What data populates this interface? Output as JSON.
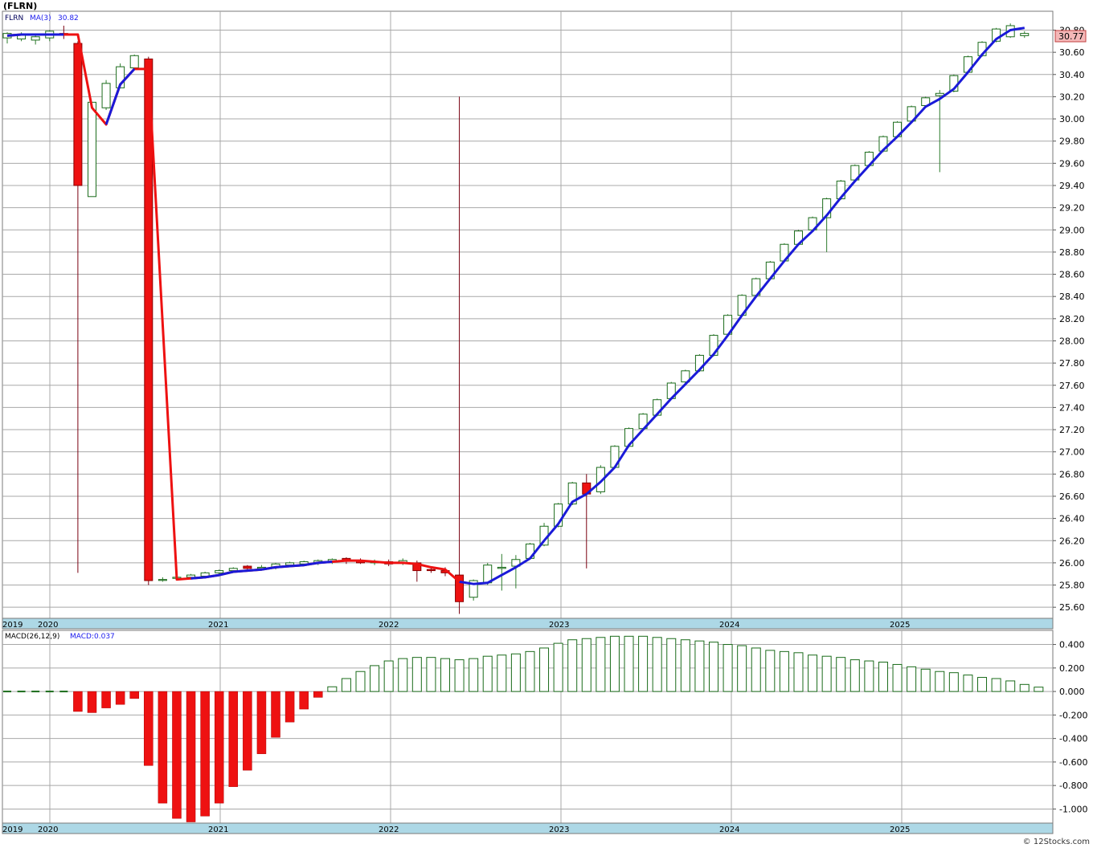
{
  "title": "(FLRN)",
  "watermark": "© 12Stocks.com",
  "chart_data": [
    {
      "type": "candlestick",
      "ticker": "FLRN",
      "ma_label": "MA(3)",
      "ma_value": "30.82",
      "last_price": "30.77",
      "ylim": [
        25.5,
        30.97
      ],
      "yticks": [
        "30.80",
        "30.60",
        "30.40",
        "30.20",
        "30.00",
        "29.80",
        "29.60",
        "29.40",
        "29.20",
        "29.00",
        "28.80",
        "28.60",
        "28.40",
        "28.20",
        "28.00",
        "27.80",
        "27.60",
        "27.40",
        "27.20",
        "27.00",
        "26.80",
        "26.60",
        "26.40",
        "26.20",
        "26.00",
        "25.80",
        "25.60"
      ],
      "year_labels": [
        "2019",
        "2020",
        "2021",
        "2022",
        "2023",
        "2024",
        "2025"
      ],
      "candles": [
        {
          "o": 30.73,
          "h": 30.78,
          "l": 30.68,
          "c": 30.77
        },
        {
          "o": 30.72,
          "h": 30.78,
          "l": 30.7,
          "c": 30.76
        },
        {
          "o": 30.71,
          "h": 30.76,
          "l": 30.67,
          "c": 30.74
        },
        {
          "o": 30.73,
          "h": 30.8,
          "l": 30.7,
          "c": 30.79
        },
        {
          "o": 30.77,
          "h": 30.84,
          "l": 30.72,
          "c": 30.76
        },
        {
          "o": 30.68,
          "h": 30.7,
          "l": 25.91,
          "c": 29.4
        },
        {
          "o": 29.3,
          "h": 30.15,
          "l": 29.3,
          "c": 30.15
        },
        {
          "o": 30.1,
          "h": 30.35,
          "l": 30.08,
          "c": 30.32
        },
        {
          "o": 30.28,
          "h": 30.5,
          "l": 30.28,
          "c": 30.47
        },
        {
          "o": 30.46,
          "h": 30.58,
          "l": 30.46,
          "c": 30.57
        },
        {
          "o": 30.54,
          "h": 30.56,
          "l": 25.8,
          "c": 25.84
        },
        {
          "o": 25.85,
          "h": 25.87,
          "l": 25.83,
          "c": 25.85
        },
        {
          "o": 25.86,
          "h": 25.89,
          "l": 25.84,
          "c": 25.87
        },
        {
          "o": 25.87,
          "h": 25.9,
          "l": 25.85,
          "c": 25.89
        },
        {
          "o": 25.88,
          "h": 25.92,
          "l": 25.86,
          "c": 25.91
        },
        {
          "o": 25.91,
          "h": 25.94,
          "l": 25.89,
          "c": 25.93
        },
        {
          "o": 25.93,
          "h": 25.96,
          "l": 25.91,
          "c": 25.95
        },
        {
          "o": 25.97,
          "h": 25.98,
          "l": 25.93,
          "c": 25.95
        },
        {
          "o": 25.95,
          "h": 25.98,
          "l": 25.93,
          "c": 25.96
        },
        {
          "o": 25.96,
          "h": 26.0,
          "l": 25.94,
          "c": 25.99
        },
        {
          "o": 25.98,
          "h": 26.01,
          "l": 25.96,
          "c": 26.0
        },
        {
          "o": 25.99,
          "h": 26.02,
          "l": 25.97,
          "c": 26.01
        },
        {
          "o": 26.0,
          "h": 26.03,
          "l": 25.98,
          "c": 26.02
        },
        {
          "o": 26.01,
          "h": 26.04,
          "l": 25.99,
          "c": 26.03
        },
        {
          "o": 26.04,
          "h": 26.05,
          "l": 25.99,
          "c": 26.02
        },
        {
          "o": 26.02,
          "h": 26.04,
          "l": 25.99,
          "c": 26.0
        },
        {
          "o": 26.0,
          "h": 26.03,
          "l": 25.98,
          "c": 26.01
        },
        {
          "o": 26.01,
          "h": 26.03,
          "l": 25.97,
          "c": 25.99
        },
        {
          "o": 26.0,
          "h": 26.04,
          "l": 25.98,
          "c": 26.02
        },
        {
          "o": 26.0,
          "h": 26.02,
          "l": 25.83,
          "c": 25.93
        },
        {
          "o": 25.94,
          "h": 25.97,
          "l": 25.91,
          "c": 25.93
        },
        {
          "o": 25.93,
          "h": 25.96,
          "l": 25.88,
          "c": 25.91
        },
        {
          "o": 25.89,
          "h": 30.2,
          "l": 25.54,
          "c": 25.65
        },
        {
          "o": 25.69,
          "h": 25.85,
          "l": 25.66,
          "c": 25.84
        },
        {
          "o": 25.82,
          "h": 26.0,
          "l": 25.8,
          "c": 25.98
        },
        {
          "o": 25.95,
          "h": 26.08,
          "l": 25.75,
          "c": 25.96
        },
        {
          "o": 25.97,
          "h": 26.07,
          "l": 25.77,
          "c": 26.03
        },
        {
          "o": 26.04,
          "h": 26.18,
          "l": 26.03,
          "c": 26.17
        },
        {
          "o": 26.16,
          "h": 26.36,
          "l": 26.15,
          "c": 26.33
        },
        {
          "o": 26.33,
          "h": 26.54,
          "l": 26.32,
          "c": 26.53
        },
        {
          "o": 26.53,
          "h": 26.73,
          "l": 26.52,
          "c": 26.72
        },
        {
          "o": 26.72,
          "h": 26.8,
          "l": 25.95,
          "c": 26.62
        },
        {
          "o": 26.64,
          "h": 26.88,
          "l": 26.62,
          "c": 26.86
        },
        {
          "o": 26.86,
          "h": 27.06,
          "l": 26.85,
          "c": 27.05
        },
        {
          "o": 27.05,
          "h": 27.22,
          "l": 27.04,
          "c": 27.21
        },
        {
          "o": 27.21,
          "h": 27.35,
          "l": 27.2,
          "c": 27.34
        },
        {
          "o": 27.33,
          "h": 27.48,
          "l": 27.32,
          "c": 27.47
        },
        {
          "o": 27.48,
          "h": 27.63,
          "l": 27.47,
          "c": 27.62
        },
        {
          "o": 27.63,
          "h": 27.74,
          "l": 27.62,
          "c": 27.73
        },
        {
          "o": 27.73,
          "h": 27.88,
          "l": 27.72,
          "c": 27.87
        },
        {
          "o": 27.87,
          "h": 28.06,
          "l": 27.86,
          "c": 28.05
        },
        {
          "o": 28.06,
          "h": 28.24,
          "l": 28.05,
          "c": 28.23
        },
        {
          "o": 28.23,
          "h": 28.42,
          "l": 28.22,
          "c": 28.41
        },
        {
          "o": 28.41,
          "h": 28.57,
          "l": 28.4,
          "c": 28.56
        },
        {
          "o": 28.56,
          "h": 28.72,
          "l": 28.55,
          "c": 28.71
        },
        {
          "o": 28.72,
          "h": 28.88,
          "l": 28.71,
          "c": 28.87
        },
        {
          "o": 28.87,
          "h": 29.0,
          "l": 28.86,
          "c": 28.99
        },
        {
          "o": 29.0,
          "h": 29.12,
          "l": 28.99,
          "c": 29.11
        },
        {
          "o": 29.11,
          "h": 29.29,
          "l": 28.8,
          "c": 29.28
        },
        {
          "o": 29.28,
          "h": 29.45,
          "l": 29.27,
          "c": 29.44
        },
        {
          "o": 29.45,
          "h": 29.59,
          "l": 29.44,
          "c": 29.58
        },
        {
          "o": 29.58,
          "h": 29.71,
          "l": 29.57,
          "c": 29.7
        },
        {
          "o": 29.71,
          "h": 29.85,
          "l": 29.7,
          "c": 29.84
        },
        {
          "o": 29.84,
          "h": 29.98,
          "l": 29.83,
          "c": 29.97
        },
        {
          "o": 29.98,
          "h": 30.12,
          "l": 29.97,
          "c": 30.11
        },
        {
          "o": 30.12,
          "h": 30.2,
          "l": 30.11,
          "c": 30.19
        },
        {
          "o": 30.21,
          "h": 30.26,
          "l": 29.52,
          "c": 30.23
        },
        {
          "o": 30.25,
          "h": 30.4,
          "l": 30.24,
          "c": 30.39
        },
        {
          "o": 30.42,
          "h": 30.57,
          "l": 30.41,
          "c": 30.56
        },
        {
          "o": 30.57,
          "h": 30.7,
          "l": 30.56,
          "c": 30.69
        },
        {
          "o": 30.7,
          "h": 30.82,
          "l": 30.69,
          "c": 30.81
        },
        {
          "o": 30.74,
          "h": 30.86,
          "l": 30.73,
          "c": 30.84
        },
        {
          "o": 30.75,
          "h": 30.79,
          "l": 30.73,
          "c": 30.77
        }
      ],
      "ma3": [
        30.75,
        30.76,
        30.76,
        30.76,
        30.76,
        30.76,
        30.1,
        29.95,
        30.31,
        30.45,
        30.45,
        null,
        25.85,
        25.86,
        25.87,
        25.89,
        25.92,
        25.93,
        25.94,
        25.96,
        25.97,
        25.98,
        26.0,
        26.01,
        26.02,
        26.02,
        26.01,
        26.0,
        26.0,
        25.99,
        25.96,
        25.94,
        25.83,
        25.81,
        25.82,
        25.89,
        25.96,
        26.04,
        26.2,
        26.35,
        26.55,
        26.62,
        26.73,
        26.86,
        27.06,
        27.2,
        27.34,
        27.48,
        27.61,
        27.74,
        27.88,
        28.05,
        28.23,
        28.4,
        28.56,
        28.72,
        28.87,
        28.99,
        29.13,
        29.29,
        29.44,
        29.58,
        29.72,
        29.84,
        29.97,
        30.11,
        30.18,
        30.27,
        30.42,
        30.58,
        30.72,
        30.8,
        30.82
      ]
    },
    {
      "type": "bar",
      "label": "MACD(26,12,9)",
      "value_label": "MACD:0.037",
      "ylim": [
        -1.12,
        0.52
      ],
      "yticks": [
        "0.400",
        "0.200",
        "0.000",
        "-0.200",
        "-0.400",
        "-0.600",
        "-0.800",
        "-1.000"
      ],
      "year_labels": [
        "2019",
        "2020",
        "2021",
        "2022",
        "2023",
        "2024",
        "2025"
      ],
      "values": [
        0.0,
        0.0,
        0.0,
        0.0,
        0.0,
        -0.17,
        -0.18,
        -0.14,
        -0.11,
        -0.06,
        -0.63,
        -0.95,
        -1.08,
        -1.11,
        -1.06,
        -0.95,
        -0.81,
        -0.67,
        -0.53,
        -0.39,
        -0.26,
        -0.15,
        -0.05,
        0.04,
        0.11,
        0.17,
        0.22,
        0.26,
        0.28,
        0.29,
        0.29,
        0.28,
        0.27,
        0.28,
        0.3,
        0.31,
        0.32,
        0.34,
        0.37,
        0.41,
        0.44,
        0.45,
        0.46,
        0.47,
        0.47,
        0.47,
        0.46,
        0.45,
        0.44,
        0.43,
        0.42,
        0.4,
        0.39,
        0.37,
        0.35,
        0.34,
        0.33,
        0.31,
        0.3,
        0.29,
        0.27,
        0.26,
        0.25,
        0.23,
        0.21,
        0.19,
        0.17,
        0.16,
        0.14,
        0.12,
        0.11,
        0.09,
        0.06,
        0.037
      ]
    }
  ]
}
